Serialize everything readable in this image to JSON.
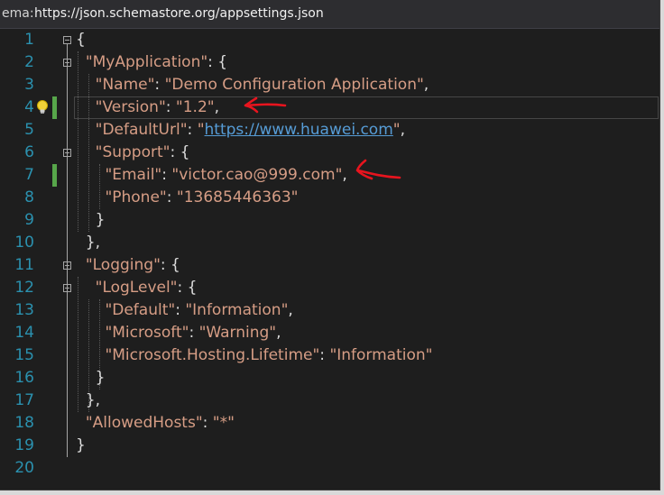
{
  "schema_bar": {
    "label": "ema:",
    "url": "https://json.schemastore.org/appsettings.json"
  },
  "icons": {
    "fold": "collapse-box-icon",
    "lightbulb": "lightbulb-icon",
    "annotation": "red-hand-drawn-arrow"
  },
  "colors": {
    "background": "#1e1e1e",
    "line_number": "#2b91af",
    "string": "#d69d85",
    "punctuation": "#dcdcdc",
    "link": "#569cd6",
    "change_bar": "#57a64a",
    "annotation": "#e8141e"
  },
  "lines": [
    {
      "n": "1",
      "tokens": [
        {
          "t": "p",
          "v": "{"
        }
      ]
    },
    {
      "n": "2",
      "tokens": [
        {
          "t": "p",
          "v": "  "
        },
        {
          "t": "k",
          "v": "\"MyApplication\""
        },
        {
          "t": "p",
          "v": ": {"
        }
      ]
    },
    {
      "n": "3",
      "tokens": [
        {
          "t": "p",
          "v": "    "
        },
        {
          "t": "k",
          "v": "\"Name\""
        },
        {
          "t": "p",
          "v": ": "
        },
        {
          "t": "s",
          "v": "\"Demo Configuration Application\""
        },
        {
          "t": "p",
          "v": ","
        }
      ]
    },
    {
      "n": "4",
      "tokens": [
        {
          "t": "p",
          "v": "    "
        },
        {
          "t": "k",
          "v": "\"Version\""
        },
        {
          "t": "p",
          "v": ": "
        },
        {
          "t": "s",
          "v": "\"1.2\""
        },
        {
          "t": "p",
          "v": ","
        }
      ]
    },
    {
      "n": "5",
      "tokens": [
        {
          "t": "p",
          "v": "    "
        },
        {
          "t": "k",
          "v": "\"DefaultUrl\""
        },
        {
          "t": "p",
          "v": ": "
        },
        {
          "t": "s",
          "v": "\""
        },
        {
          "t": "u",
          "v": "https://www.huawei.com"
        },
        {
          "t": "s",
          "v": "\""
        },
        {
          "t": "p",
          "v": ","
        }
      ]
    },
    {
      "n": "6",
      "tokens": [
        {
          "t": "p",
          "v": "    "
        },
        {
          "t": "k",
          "v": "\"Support\""
        },
        {
          "t": "p",
          "v": ": {"
        }
      ]
    },
    {
      "n": "7",
      "tokens": [
        {
          "t": "p",
          "v": "      "
        },
        {
          "t": "k",
          "v": "\"Email\""
        },
        {
          "t": "p",
          "v": ": "
        },
        {
          "t": "s",
          "v": "\"victor.cao@999.com\""
        },
        {
          "t": "p",
          "v": ","
        }
      ]
    },
    {
      "n": "8",
      "tokens": [
        {
          "t": "p",
          "v": "      "
        },
        {
          "t": "k",
          "v": "\"Phone\""
        },
        {
          "t": "p",
          "v": ": "
        },
        {
          "t": "s",
          "v": "\"13685446363\""
        }
      ]
    },
    {
      "n": "9",
      "tokens": [
        {
          "t": "p",
          "v": "    }"
        }
      ]
    },
    {
      "n": "10",
      "tokens": [
        {
          "t": "p",
          "v": "  },"
        }
      ]
    },
    {
      "n": "11",
      "tokens": [
        {
          "t": "p",
          "v": "  "
        },
        {
          "t": "k",
          "v": "\"Logging\""
        },
        {
          "t": "p",
          "v": ": {"
        }
      ]
    },
    {
      "n": "12",
      "tokens": [
        {
          "t": "p",
          "v": "    "
        },
        {
          "t": "k",
          "v": "\"LogLevel\""
        },
        {
          "t": "p",
          "v": ": {"
        }
      ]
    },
    {
      "n": "13",
      "tokens": [
        {
          "t": "p",
          "v": "      "
        },
        {
          "t": "k",
          "v": "\"Default\""
        },
        {
          "t": "p",
          "v": ": "
        },
        {
          "t": "s",
          "v": "\"Information\""
        },
        {
          "t": "p",
          "v": ","
        }
      ]
    },
    {
      "n": "14",
      "tokens": [
        {
          "t": "p",
          "v": "      "
        },
        {
          "t": "k",
          "v": "\"Microsoft\""
        },
        {
          "t": "p",
          "v": ": "
        },
        {
          "t": "s",
          "v": "\"Warning\""
        },
        {
          "t": "p",
          "v": ","
        }
      ]
    },
    {
      "n": "15",
      "tokens": [
        {
          "t": "p",
          "v": "      "
        },
        {
          "t": "k",
          "v": "\"Microsoft.Hosting.Lifetime\""
        },
        {
          "t": "p",
          "v": ": "
        },
        {
          "t": "s",
          "v": "\"Information\""
        }
      ]
    },
    {
      "n": "16",
      "tokens": [
        {
          "t": "p",
          "v": "    }"
        }
      ]
    },
    {
      "n": "17",
      "tokens": [
        {
          "t": "p",
          "v": "  },"
        }
      ]
    },
    {
      "n": "18",
      "tokens": [
        {
          "t": "p",
          "v": "  "
        },
        {
          "t": "k",
          "v": "\"AllowedHosts\""
        },
        {
          "t": "p",
          "v": ": "
        },
        {
          "t": "s",
          "v": "\"*\""
        }
      ]
    },
    {
      "n": "19",
      "tokens": [
        {
          "t": "p",
          "v": "}"
        }
      ]
    },
    {
      "n": "20",
      "tokens": []
    }
  ]
}
